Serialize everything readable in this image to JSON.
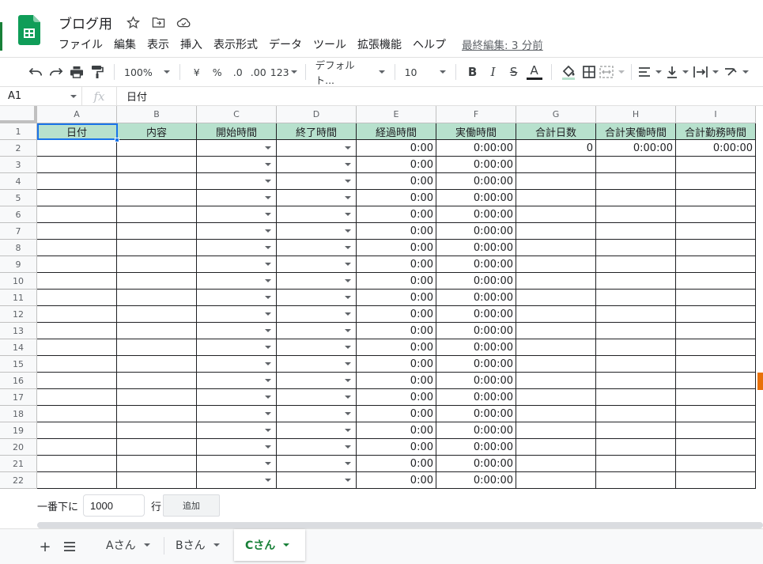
{
  "header": {
    "doc_title": "ブログ用",
    "menu": [
      "ファイル",
      "編集",
      "表示",
      "挿入",
      "表示形式",
      "データ",
      "ツール",
      "拡張機能",
      "ヘルプ"
    ],
    "last_edit": "最終編集: 3 分前"
  },
  "toolbar": {
    "zoom": "100%",
    "currency": "¥",
    "percent": "%",
    "dec_less": ".0",
    "dec_more": ".00",
    "format_more": "123",
    "font": "デフォルト...",
    "font_size": "10",
    "bold": "B",
    "italic": "I",
    "strike": "S",
    "text_color": "A"
  },
  "formula_bar": {
    "cell_ref": "A1",
    "fx": "fx",
    "content": "日付"
  },
  "grid": {
    "columns": [
      "A",
      "B",
      "C",
      "D",
      "E",
      "F",
      "G",
      "H",
      "I"
    ],
    "headers": [
      "日付",
      "内容",
      "開始時間",
      "終了時間",
      "経過時間",
      "実働時間",
      "合計日数",
      "合計実働時間",
      "合計勤務時間"
    ],
    "row_numbers": [
      "1",
      "2",
      "3",
      "4",
      "5",
      "6",
      "7",
      "8",
      "9",
      "10",
      "11",
      "12",
      "13",
      "14",
      "15",
      "16",
      "17",
      "18",
      "19",
      "20",
      "21",
      "22"
    ],
    "row2_extra": {
      "g": "0",
      "h": "0:00:00",
      "i": "0:00:00"
    },
    "elapsed_value": "0:00",
    "work_value": "0:00:00"
  },
  "add_rows": {
    "label": "一番下に",
    "value": "1000",
    "unit": "行",
    "button": "追加"
  },
  "sheets": {
    "tabs": [
      "Aさん",
      "Bさん",
      "Cさん"
    ],
    "active": "Cさん"
  },
  "colors": {
    "header_fill": "#b7e1cd",
    "accent_green": "#188038",
    "selection_blue": "#1a73e8"
  }
}
